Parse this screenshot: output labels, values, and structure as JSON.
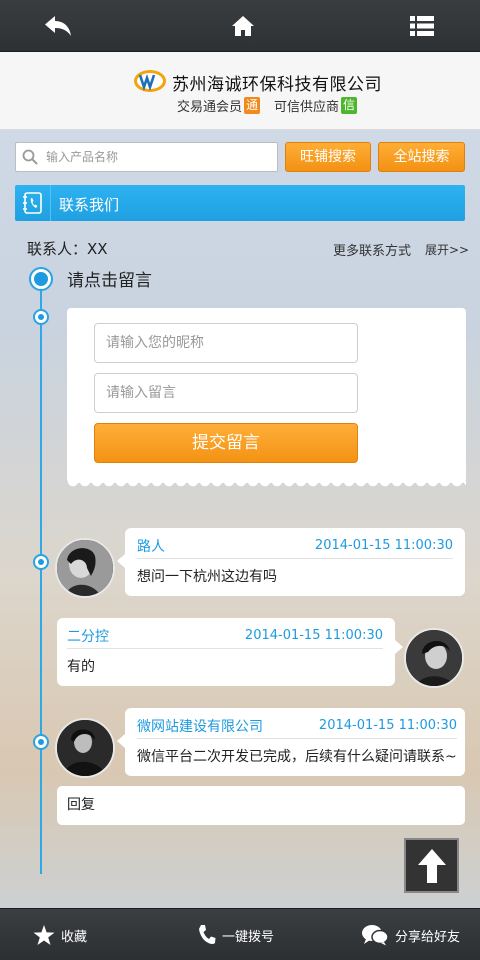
{
  "header": {
    "company_name": "苏州海诚环保科技有限公司",
    "member_label": "交易通会员",
    "member_badge": "通",
    "supplier_label": "可信供应商",
    "supplier_badge": "信"
  },
  "search": {
    "placeholder": "输入产品名称",
    "shop_search_label": "旺铺搜索",
    "site_search_label": "全站搜索"
  },
  "contact": {
    "section_title": "联系我们",
    "contact_person": "联系人：XX",
    "more_contact": "更多联系方式",
    "expand": "展开>>"
  },
  "message_form": {
    "prompt": "请点击留言",
    "nickname_placeholder": "请输入您的昵称",
    "message_placeholder": "请输入留言",
    "submit_label": "提交留言"
  },
  "messages": [
    {
      "name": "路人",
      "time": "2014-01-15  11:00:30",
      "text": "想问一下杭州这边有吗"
    },
    {
      "name": "二分控",
      "time": "2014-01-15  11:00:30",
      "text": "有的"
    },
    {
      "name": "微网站建设有限公司",
      "time": "2014-01-15  11:00:30",
      "text": "微信平台二次开发已完成，后续有什么疑问请联系~"
    }
  ],
  "reply_label": "回复",
  "bottom_bar": {
    "favorite": "收藏",
    "call": "一键拨号",
    "share": "分享给好友"
  },
  "colors": {
    "accent_blue": "#1e9be0",
    "accent_orange": "#f39113",
    "bar_dark": "#2e3134"
  }
}
